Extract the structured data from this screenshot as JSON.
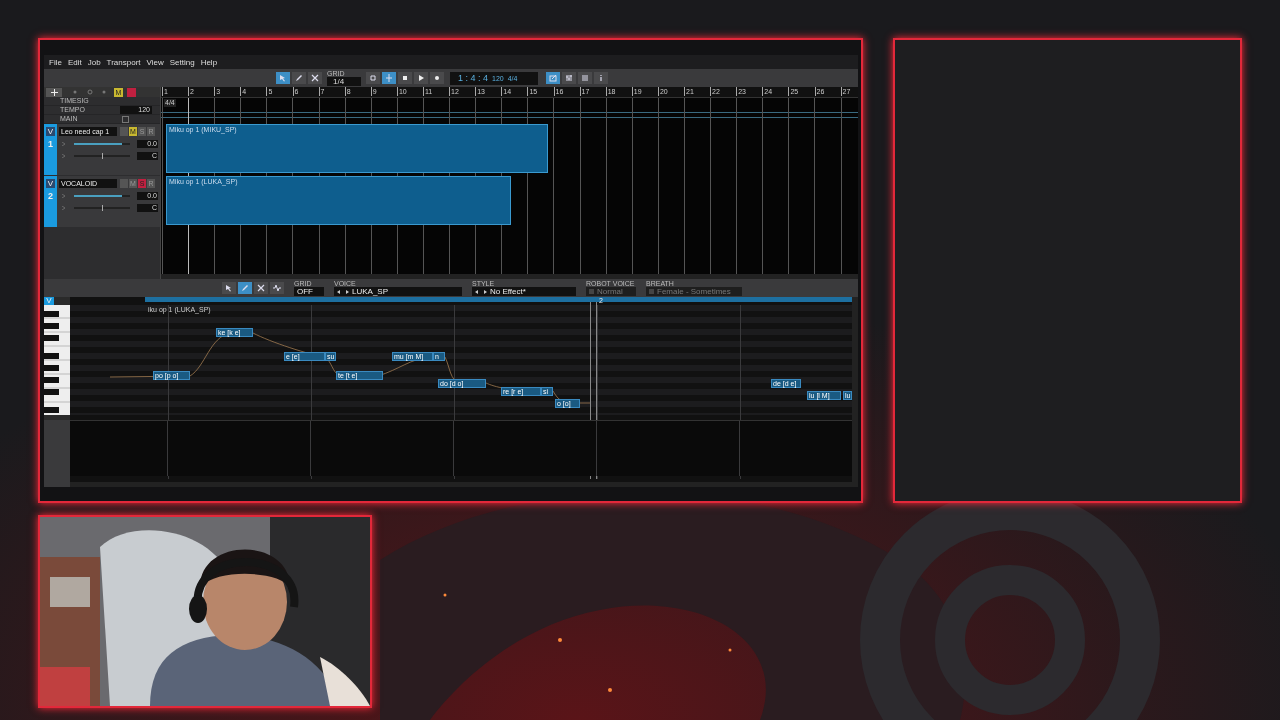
{
  "menu": [
    "File",
    "Edit",
    "Job",
    "Transport",
    "View",
    "Setting",
    "Help"
  ],
  "toolbar": {
    "tools": [
      {
        "kind": "pointer",
        "selected": true
      },
      {
        "kind": "pencil",
        "selected": false
      },
      {
        "kind": "scissors",
        "selected": false
      }
    ],
    "grid": {
      "label": "GRID",
      "value": "1/4"
    },
    "toggles": [
      {
        "kind": "loop",
        "selected": false
      },
      {
        "kind": "follow",
        "selected": true
      }
    ],
    "time": "1 : 4 : 4",
    "tempo": "120",
    "timesig": "4/4",
    "views": [
      {
        "kind": "editor",
        "selected": true
      },
      {
        "kind": "mixer",
        "selected": false
      },
      {
        "kind": "list",
        "selected": false
      },
      {
        "kind": "info",
        "selected": false
      }
    ]
  },
  "master_buttons": [
    {
      "label": "M",
      "checked": true
    }
  ],
  "master_rows": [
    {
      "label": "TIMESIG"
    },
    {
      "label": "TEMPO",
      "value": "120"
    },
    {
      "label": "MAIN",
      "checked": false
    }
  ],
  "ruler": [
    "1",
    "2",
    "3",
    "4",
    "5",
    "6",
    "7",
    "8",
    "9",
    "10",
    "11",
    "12",
    "13",
    "14",
    "15",
    "16",
    "17",
    "18",
    "19",
    "20",
    "21",
    "22",
    "23",
    "24",
    "25",
    "26",
    "27"
  ],
  "timesig_marker": "4/4",
  "tracks": [
    {
      "letter": "V",
      "number": "1",
      "name": "Leo need cap 1",
      "buttons": [
        {
          "checked": false
        },
        {
          "label": "M",
          "checked": true
        },
        {
          "label": "S",
          "checked": false
        },
        {
          "label": "R",
          "checked": false
        }
      ],
      "volume": {
        "level": 0.85,
        "reading": "0.0"
      },
      "pan": {
        "level": 0.5,
        "reading": "C"
      },
      "clip": "Miku op 1 (MIKU_SP)"
    },
    {
      "letter": "V",
      "number": "2",
      "name": "VOCALOID",
      "buttons": [
        {
          "checked": false
        },
        {
          "label": "M",
          "checked": false
        },
        {
          "label": "S",
          "checked": true
        },
        {
          "label": "R",
          "checked": false
        }
      ],
      "volume": {
        "level": 0.85,
        "reading": "0.0"
      },
      "pan": {
        "level": 0.5,
        "reading": "C"
      },
      "clip": "Miku op 1 (LUKA_SP)"
    }
  ],
  "editor": {
    "tools": [
      {
        "kind": "pointer",
        "selected": false
      },
      {
        "kind": "pencil",
        "selected": true
      },
      {
        "kind": "scissors",
        "selected": false
      },
      {
        "kind": "wave",
        "selected": false
      }
    ],
    "fields": [
      {
        "label": "GRID",
        "value": "OFF",
        "arrows": false,
        "disabled": false
      },
      {
        "label": "VOICE",
        "value": "LUKA_SP",
        "arrows": true,
        "disabled": false
      },
      {
        "label": "STYLE",
        "value": "No Effect*",
        "arrows": true,
        "disabled": false
      },
      {
        "label": "ROBOT VOICE",
        "value": "Normal",
        "arrows": false,
        "disabled": true
      },
      {
        "label": "BREATH",
        "value": "Female - Sometimes",
        "arrows": false,
        "disabled": true
      }
    ]
  },
  "piano_roll": {
    "tab": "V",
    "part_name": "iku op 1 (LUKA_SP)",
    "ruler_mark": "2",
    "notes": [
      {
        "lyric": "po [p o]"
      },
      {
        "lyric": "ke [k e]"
      },
      {
        "lyric": "e [e]"
      },
      {
        "lyric": "su"
      },
      {
        "lyric": "te [t e]"
      },
      {
        "lyric": "mu [m M]"
      },
      {
        "lyric": "n"
      },
      {
        "lyric": "do [d o]"
      },
      {
        "lyric": "re [r e]"
      },
      {
        "lyric": "si"
      },
      {
        "lyric": "o [o]"
      },
      {
        "lyric": "de [d e]"
      },
      {
        "lyric": "lu [l M]"
      },
      {
        "lyric": "lu"
      }
    ]
  }
}
